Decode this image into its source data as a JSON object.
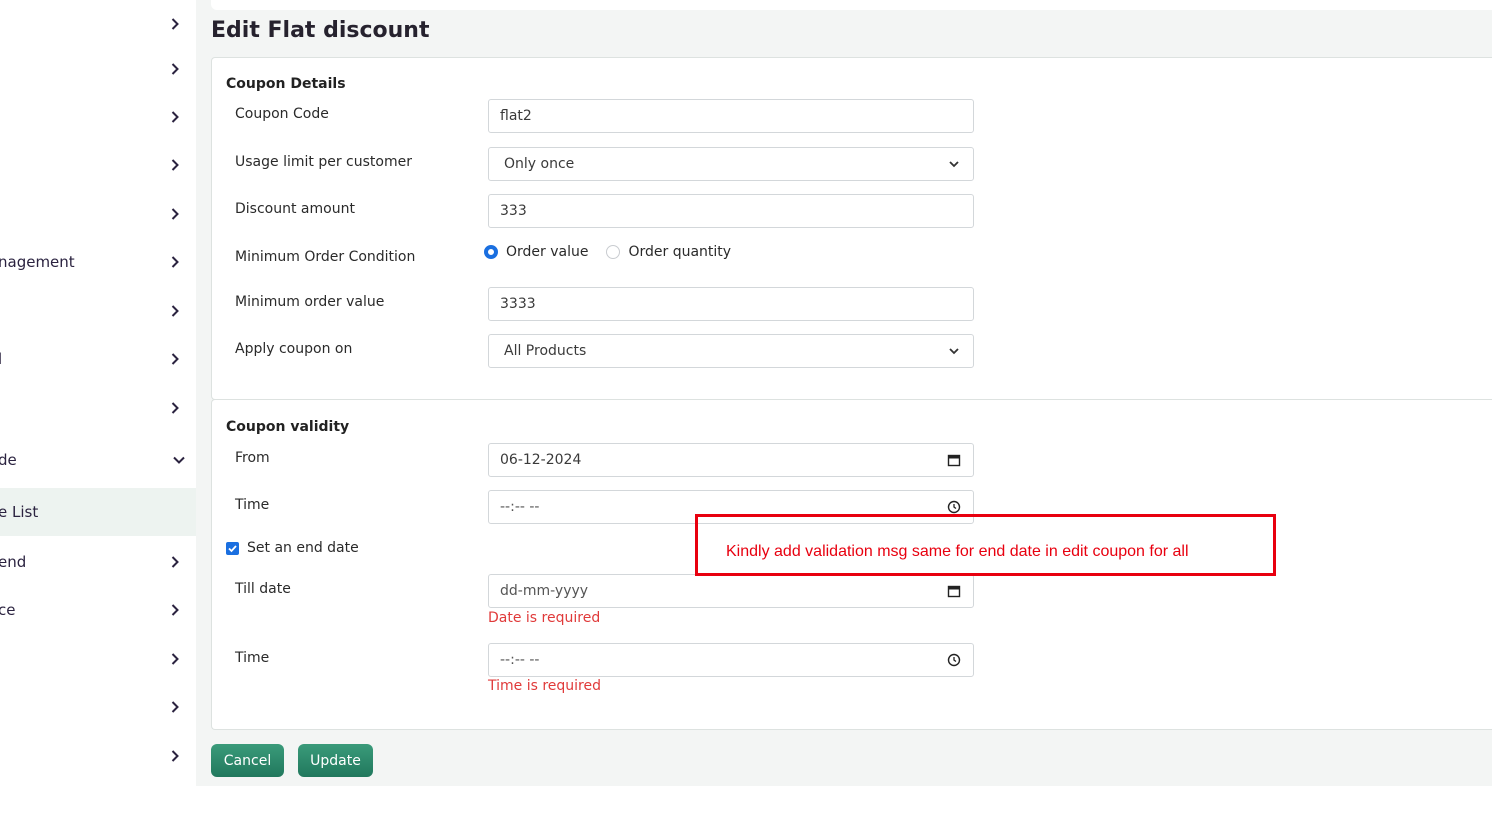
{
  "sidebar": {
    "items": [
      {
        "label": "",
        "chevron": "right"
      },
      {
        "label": "",
        "chevron": "right"
      },
      {
        "label": "",
        "chevron": "right"
      },
      {
        "label": "",
        "chevron": "right"
      },
      {
        "label": "",
        "chevron": "right"
      },
      {
        "label": "nagement",
        "chevron": "right"
      },
      {
        "label": "",
        "chevron": "right"
      },
      {
        "label": "l",
        "chevron": "right"
      },
      {
        "label": "",
        "chevron": "right"
      },
      {
        "label": "de",
        "chevron": "down"
      },
      {
        "label": "e List",
        "chevron": "",
        "active": true
      },
      {
        "label": "end",
        "chevron": "right"
      },
      {
        "label": "ce",
        "chevron": "right"
      },
      {
        "label": "",
        "chevron": "right"
      },
      {
        "label": "",
        "chevron": "right"
      },
      {
        "label": "",
        "chevron": "right"
      }
    ]
  },
  "page": {
    "title": "Edit Flat discount"
  },
  "coupon_details": {
    "section_title": "Coupon Details",
    "coupon_code_label": "Coupon Code",
    "coupon_code_value": "flat2",
    "usage_limit_label": "Usage limit per customer",
    "usage_limit_value": "Only once",
    "discount_amount_label": "Discount amount",
    "discount_amount_value": "333",
    "min_order_condition_label": "Minimum Order Condition",
    "radio_order_value": "Order value",
    "radio_order_quantity": "Order quantity",
    "min_order_value_label": "Minimum order value",
    "min_order_value_value": "3333",
    "apply_on_label": "Apply coupon on",
    "apply_on_value": "All Products"
  },
  "coupon_validity": {
    "section_title": "Coupon validity",
    "from_label": "From",
    "from_value": "06-12-2024",
    "time_label": "Time",
    "time_value": "--:-- --",
    "end_date_checkbox_label": "Set an end date",
    "end_date_checked": true,
    "till_date_label": "Till date",
    "till_date_placeholder": "dd-mm-yyyy",
    "till_date_error": "Date is required",
    "end_time_label": "Time",
    "end_time_value": "--:-- --",
    "end_time_error": "Time is required"
  },
  "buttons": {
    "cancel": "Cancel",
    "update": "Update"
  },
  "annotation": {
    "text": "Kindly add validation msg same for end date in edit coupon for all",
    "color": "#e8000f"
  },
  "colors": {
    "accent": "#1a6fe0",
    "button": "#21785d",
    "error": "#e03a3a"
  }
}
